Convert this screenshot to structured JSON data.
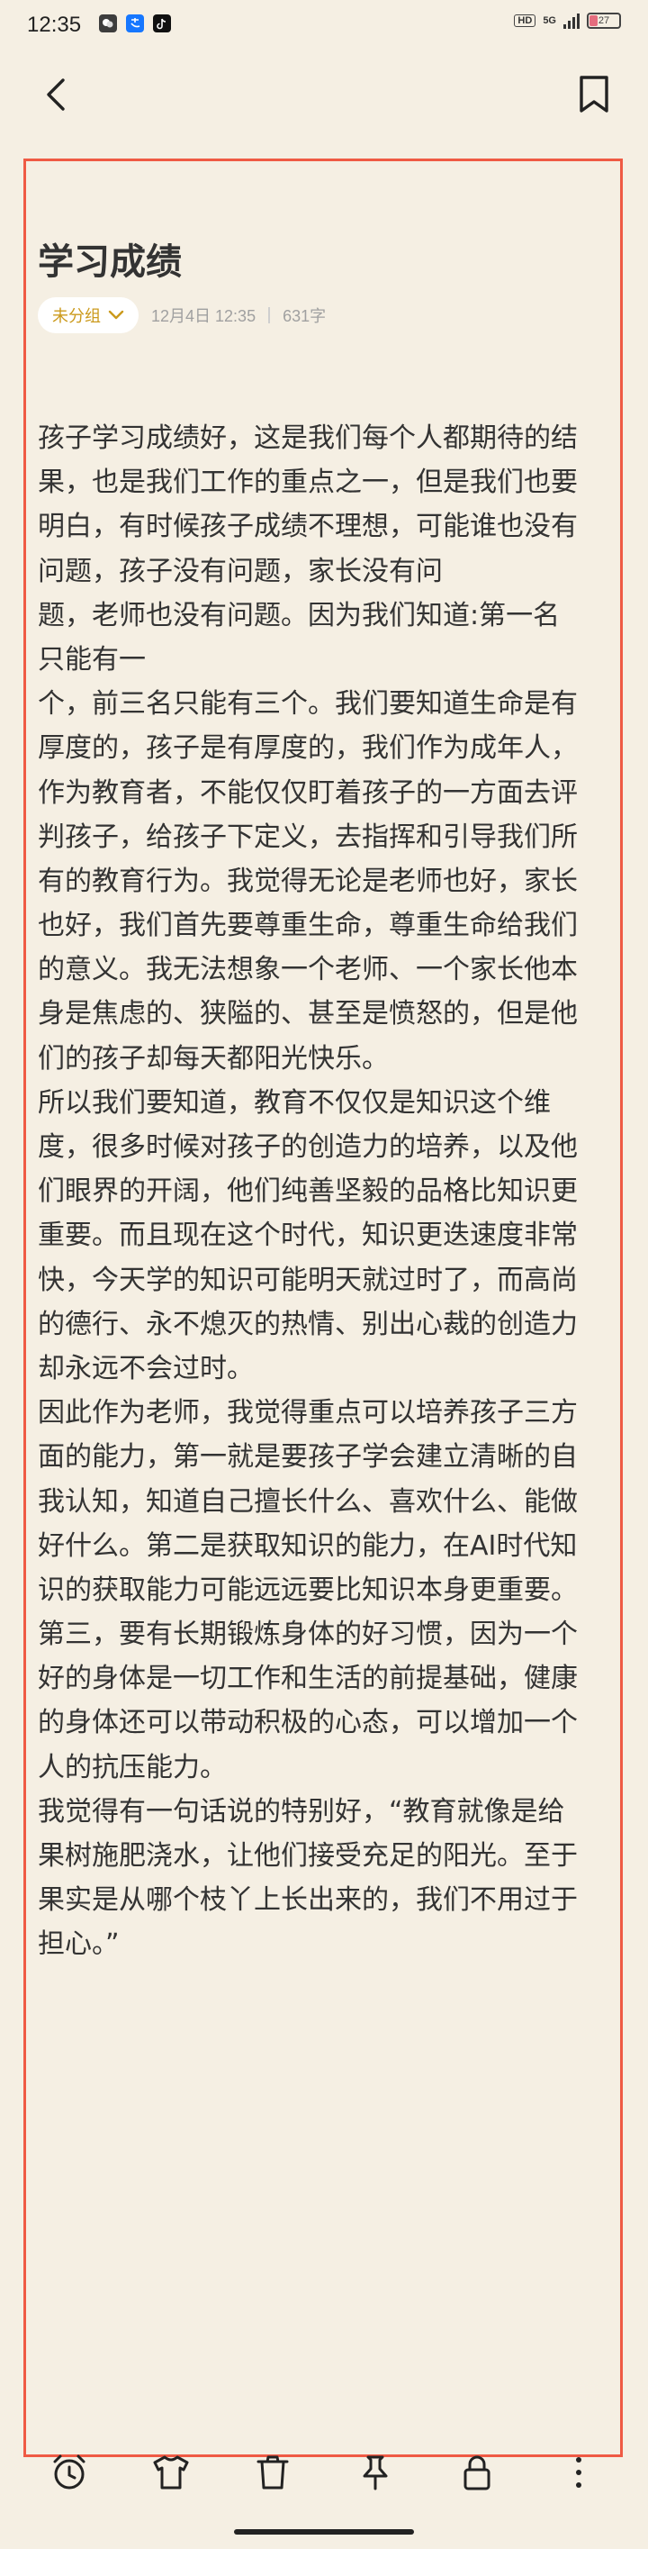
{
  "status_bar": {
    "time": "12:35",
    "app_icons": [
      "wechat-icon",
      "alipay-icon",
      "tiktok-icon"
    ],
    "network_badge": "HD",
    "network_type": "5G",
    "battery_level": "27",
    "battery_color": "#e56d7e"
  },
  "header": {
    "back_icon": "chevron-left-icon",
    "bookmark_icon": "bookmark-icon"
  },
  "note": {
    "title": "学习成绩",
    "group_label": "未分组",
    "date": "12月4日 12:35",
    "char_count": "631字",
    "lines": [
      "孩子学习成绩好，这是我们每个人都期待的结",
      "果，也是我们工作的重点之一，但是我们也要",
      "明白，有时候孩子成绩不理想，可能谁也没有",
      "问题，孩子没有问题，家长没有问",
      "题，老师也没有问题。因为我们知道:第一名",
      "只能有一",
      "个，前三名只能有三个。我们要知道生命是有",
      "厚度的，孩子是有厚度的，我们作为成年人，",
      "作为教育者，不能仅仅盯着孩子的一方面去评",
      "判孩子，给孩子下定义，去指挥和引导我们所",
      "有的教育行为。我觉得无论是老师也好，家长",
      "也好，我们首先要尊重生命，尊重生命给我们",
      "的意义。我无法想象一个老师、一个家长他本",
      "身是焦虑的、狭隘的、甚至是愤怒的，但是他",
      "们的孩子却每天都阳光快乐。",
      "所以我们要知道，教育不仅仅是知识这个维",
      "度，很多时候对孩子的创造力的培养，以及他",
      "们眼界的开阔，他们纯善坚毅的品格比知识更",
      "重要。而且现在这个时代，知识更迭速度非常",
      "快，今天学的知识可能明天就过时了，而高尚",
      "的德行、永不熄灭的热情、别出心裁的创造力",
      "却永远不会过时。",
      "因此作为老师，我觉得重点可以培养孩子三方",
      "面的能力，第一就是要孩子学会建立清晰的自",
      "我认知，知道自己擅长什么、喜欢什么、能做",
      "好什么。第二是获取知识的能力，在AI时代知",
      "识的获取能力可能远远要比知识本身更重要。",
      "第三，要有长期锻炼身体的好习惯，因为一个",
      "好的身体是一切工作和生活的前提基础，健康",
      "的身体还可以带动积极的心态，可以增加一个",
      "人的抗压能力。",
      "我觉得有一句话说的特别好，“教育就像是给",
      "果树施肥浇水，让他们接受充足的阳光。至于",
      "果实是从哪个枝丫上长出来的，我们不用过于",
      "担心。”"
    ]
  },
  "bottom_toolbar": {
    "icons": [
      "alarm-clock-icon",
      "tshirt-icon",
      "trash-icon",
      "pin-icon",
      "lock-icon",
      "more-icon"
    ]
  },
  "colors": {
    "background": "#f5efe3",
    "frame": "#ef5a44",
    "group_chip_text": "#cb9a1c"
  }
}
